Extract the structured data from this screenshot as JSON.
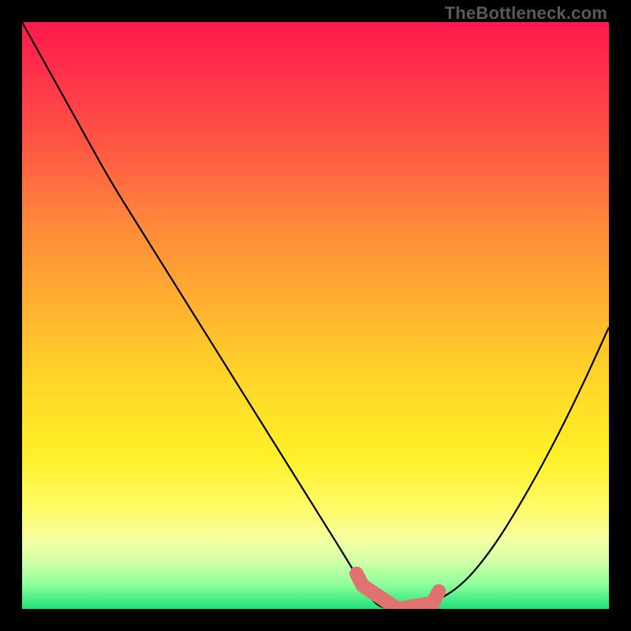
{
  "watermark": "TheBottleneck.com",
  "chart_data": {
    "type": "line",
    "title": "",
    "xlabel": "",
    "ylabel": "",
    "xlim": [
      0,
      100
    ],
    "ylim": [
      0,
      100
    ],
    "series": [
      {
        "name": "bottleneck-curve",
        "x": [
          0,
          5,
          10,
          15,
          20,
          25,
          30,
          35,
          40,
          45,
          50,
          55,
          58,
          60,
          62,
          65,
          68,
          70,
          75,
          80,
          85,
          90,
          95,
          100
        ],
        "values": [
          100,
          91,
          82,
          73,
          65,
          57,
          49,
          41,
          33,
          25,
          17,
          9,
          4,
          1,
          0,
          0,
          0,
          1,
          4,
          10,
          18,
          27,
          37,
          48
        ]
      }
    ],
    "highlight_band": {
      "name": "minimum-zone",
      "x_range": [
        58,
        70
      ],
      "y": 0
    },
    "background_gradient": {
      "stops": [
        {
          "pos": 0,
          "color": "#ff1a4d"
        },
        {
          "pos": 35,
          "color": "#ff8a3a"
        },
        {
          "pos": 62,
          "color": "#ffd828"
        },
        {
          "pos": 88,
          "color": "#f6ffa0"
        },
        {
          "pos": 100,
          "color": "#20e07a"
        }
      ]
    }
  }
}
